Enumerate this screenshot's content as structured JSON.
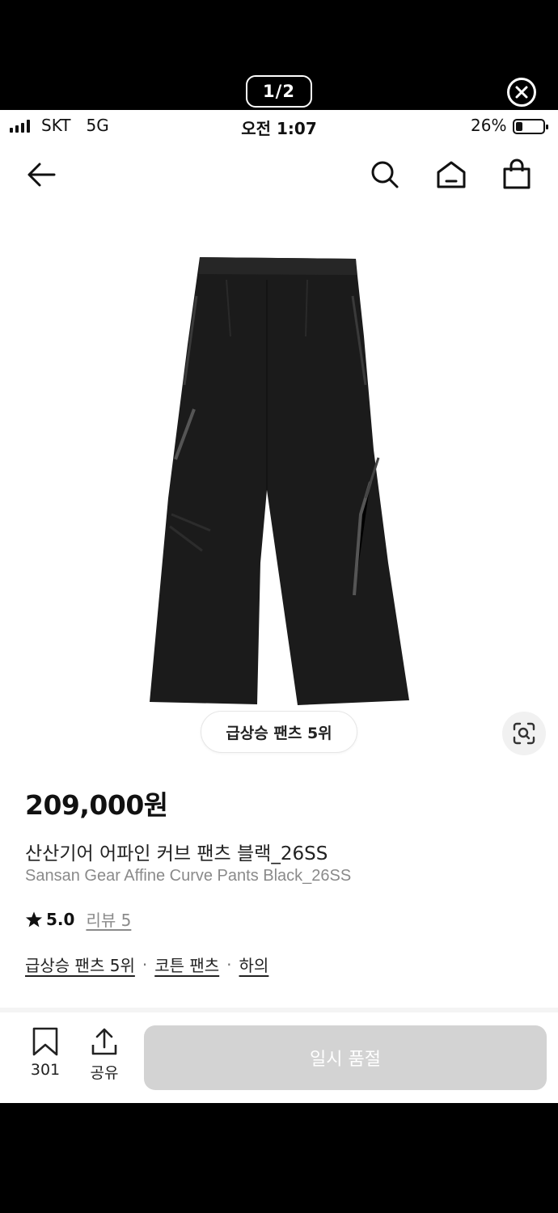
{
  "viewer": {
    "page_counter": "1/2",
    "close_icon": "close-circle-icon"
  },
  "status_bar": {
    "carrier": "SKT   5G",
    "time": "오전 1:07",
    "battery_percent": "26%",
    "battery_level": 0.26
  },
  "nav": {
    "back_icon": "arrow-left-icon",
    "search_icon": "search-icon",
    "home_icon": "home-icon",
    "cart_icon": "shopping-bag-icon"
  },
  "product": {
    "image_subject": "black wide curve pants with zippers",
    "rank_chip": "급상승 팬츠 5위",
    "lens_icon": "lens-search-icon",
    "price": "209,000원",
    "name_ko": "산산기어 어파인 커브 팬츠 블랙_26SS",
    "name_en": "Sansan Gear Affine Curve Pants Black_26SS",
    "rating": "5.0",
    "review_label": "리뷰 5",
    "tags": [
      "급상승 팬츠 5위",
      "코튼 팬츠",
      "하의"
    ],
    "tag_separator": "·"
  },
  "action_bar": {
    "bookmark_count": "301",
    "share_label": "공유",
    "soldout_label": "일시 품절"
  },
  "colors": {
    "text_primary": "#111111",
    "text_secondary": "#8a8a8a",
    "disabled_button": "#d3d3d3"
  }
}
